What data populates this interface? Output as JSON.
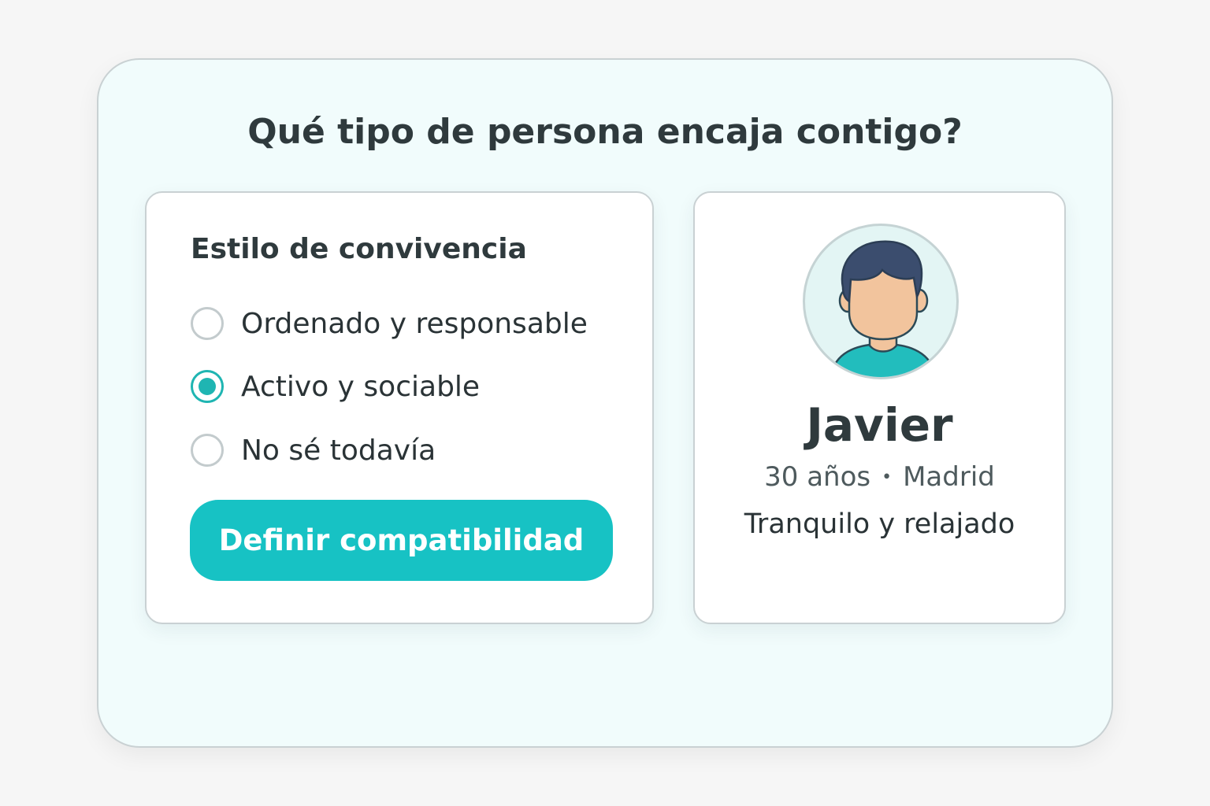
{
  "question": {
    "title": "Qué tipo de persona encaja contigo?"
  },
  "preferences": {
    "section_title": "Estilo de convivencia",
    "options": [
      {
        "label": "Ordenado y responsable",
        "selected": false
      },
      {
        "label": "Activo y sociable",
        "selected": true
      },
      {
        "label": "No sé todavía",
        "selected": false
      }
    ],
    "button_label": "Definir compatibilidad"
  },
  "profile": {
    "name": "Javier",
    "age": "30 años",
    "separator": "•",
    "city": "Madrid",
    "trait": "Tranquilo y relajado",
    "avatar_icon": "person-avatar-icon"
  },
  "colors": {
    "accent": "#17c2c4",
    "card_background": "#f1fcfc",
    "text": "#2f3a3d"
  }
}
